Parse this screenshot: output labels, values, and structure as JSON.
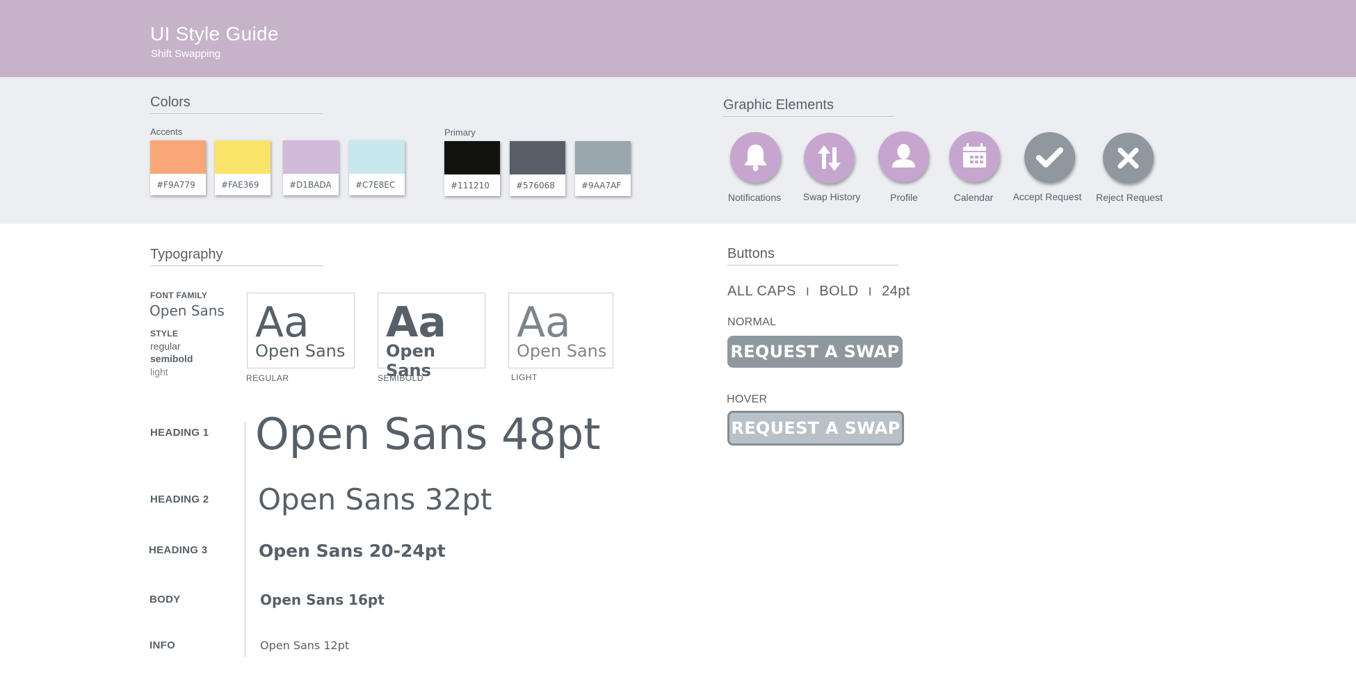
{
  "header": {
    "title": "UI Style Guide",
    "subtitle": "Shift Swapping",
    "background": "#C6B3CA"
  },
  "colors": {
    "title": "Colors",
    "accents": {
      "label": "Accents",
      "swatches": [
        {
          "hex": "#F9A779"
        },
        {
          "hex": "#FAE369"
        },
        {
          "hex": "#D1BADA"
        },
        {
          "hex": "#C7E8EC"
        }
      ]
    },
    "primary": {
      "label": "Primary",
      "swatches": [
        {
          "hex": "#111210"
        },
        {
          "hex": "#576068"
        },
        {
          "hex": "#9AA7AF"
        }
      ]
    }
  },
  "graphic_elements": {
    "title": "Graphic Elements",
    "items": [
      {
        "label": "Notifications",
        "icon": "bell-icon",
        "color": "#C6A6CF"
      },
      {
        "label": "Swap History",
        "icon": "swap-arrows-icon",
        "color": "#C6A6CF"
      },
      {
        "label": "Profile",
        "icon": "user-icon",
        "color": "#C6A6CF"
      },
      {
        "label": "Calendar",
        "icon": "calendar-icon",
        "color": "#C6A6CF"
      },
      {
        "label": "Accept Request",
        "icon": "check-icon",
        "color": "#8F989F"
      },
      {
        "label": "Reject Request",
        "icon": "close-icon",
        "color": "#8F989F"
      }
    ]
  },
  "typography": {
    "title": "Typography",
    "font_family_label": "FONT FAMILY",
    "font_family": "Open Sans",
    "style_label": "STYLE",
    "styles": [
      "regular",
      "semibold",
      "light"
    ],
    "samples": [
      {
        "aa": "Aa",
        "name": "Open Sans",
        "caption": "REGULAR"
      },
      {
        "aa": "Aa",
        "name": "Open Sans",
        "caption": "SEMIBOLD"
      },
      {
        "aa": "Aa",
        "name": "Open Sans",
        "caption": "LIGHT"
      }
    ],
    "headings": [
      {
        "label": "HEADING 1",
        "sample": "Open Sans 48pt"
      },
      {
        "label": "HEADING 2",
        "sample": "Open Sans 32pt"
      },
      {
        "label": "HEADING 3",
        "sample": "Open Sans 20-24pt"
      },
      {
        "label": "BODY",
        "sample": "Open Sans 16pt"
      },
      {
        "label": "INFO",
        "sample": "Open Sans 12pt"
      }
    ]
  },
  "buttons": {
    "title": "Buttons",
    "spec": [
      "ALL CAPS",
      "BOLD",
      "24pt"
    ],
    "separator": "I",
    "normal_label": "NORMAL",
    "hover_label": "HOVER",
    "button_text": "REQUEST A SWAP",
    "normal_color": "#8F989F",
    "hover_color": "#B7C1C7"
  }
}
